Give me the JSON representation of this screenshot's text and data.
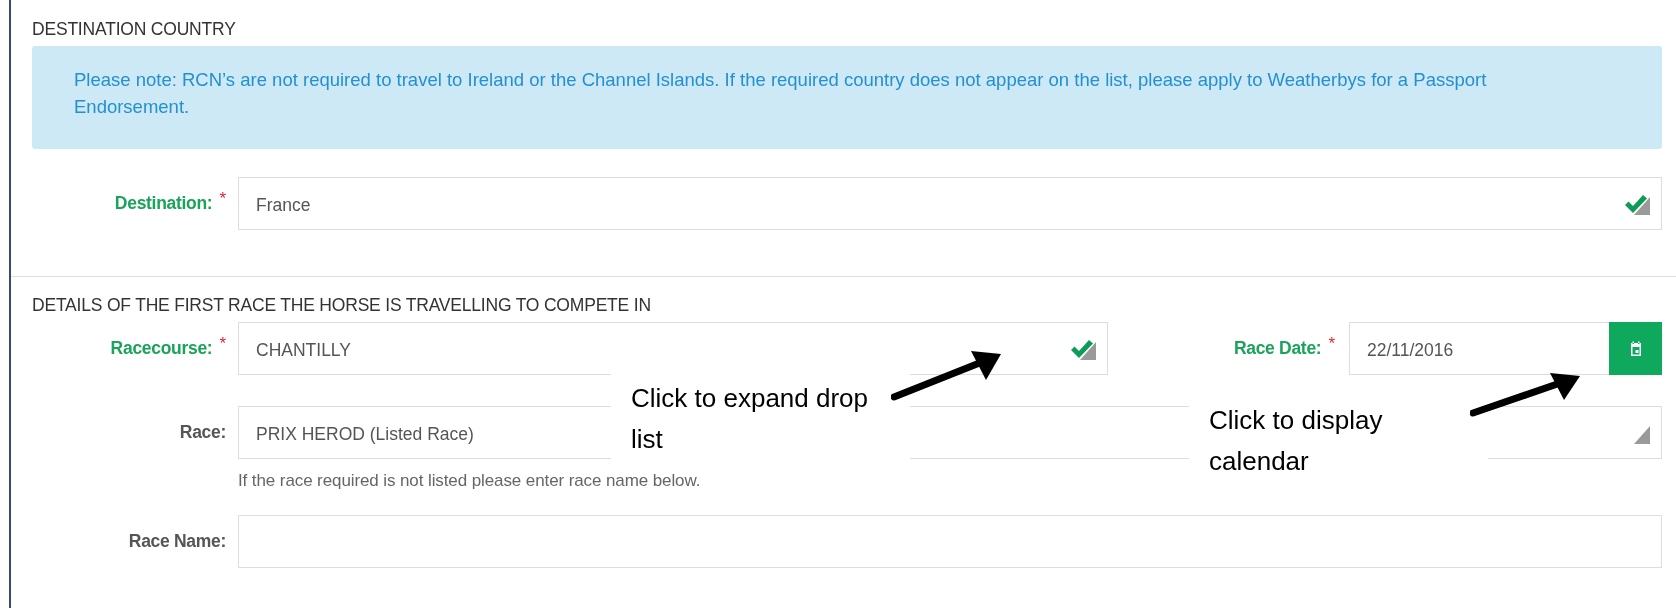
{
  "sections": [
    {
      "heading": "DESTINATION COUNTRY",
      "notice": "Please note: RCN’s are not required to travel to Ireland or the Channel Islands. If the required country does not appear on the list, please apply to Weatherbys for a Passport Endorsement.",
      "rows": [
        {
          "fields": [
            {
              "label": "Destination:",
              "required_mark": "*",
              "kind": "select",
              "value": "France",
              "valid": true
            }
          ]
        }
      ]
    },
    {
      "heading": "DETAILS OF THE FIRST RACE THE HORSE IS TRAVELLING TO COMPETE IN",
      "rows": [
        {
          "fields": [
            {
              "label": "Racecourse:",
              "required_mark": "*",
              "kind": "select",
              "value": "CHANTILLY",
              "valid": true
            },
            {
              "label": "Race Date:",
              "required_mark": "*",
              "kind": "date",
              "value": "22/11/2016"
            }
          ]
        },
        {
          "fields": [
            {
              "label": "Race:",
              "kind": "select",
              "value": "PRIX HEROD (Listed Race)",
              "valid": false,
              "help": "If the race required is not listed please enter race name below."
            }
          ]
        },
        {
          "fields": [
            {
              "label": "Race Name:",
              "kind": "text"
            }
          ]
        }
      ]
    }
  ],
  "annotations": [
    {
      "text": "Click to expand drop list"
    },
    {
      "text": "Click to display calendar"
    }
  ]
}
